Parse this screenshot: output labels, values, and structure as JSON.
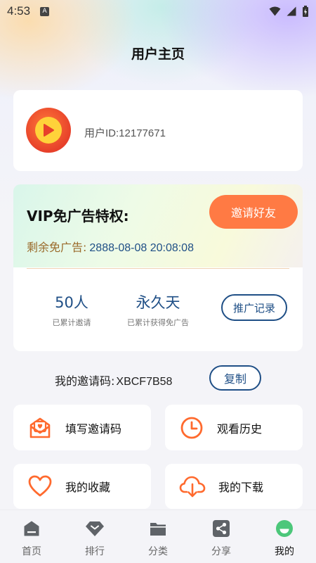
{
  "status_bar": {
    "time": "4:53",
    "indicator": "A"
  },
  "header": {
    "title": "用户主页"
  },
  "profile": {
    "user_id": "用户ID:12177671"
  },
  "vip": {
    "title": "VIP免广告特权:",
    "invite_button": "邀请好友",
    "remaining_label": "剩余免广告:",
    "remaining_date": "2888-08-08 20:08:08",
    "invited_count": "50人",
    "invited_label": "已累计邀请",
    "earned_value": "永久天",
    "earned_label": "已累计获得免广告",
    "records_button": "推广记录"
  },
  "invite_code": {
    "label": "我的邀请码:",
    "code": "XBCF7B58",
    "copy_button": "复制"
  },
  "menu": [
    {
      "label": "填写邀请码",
      "icon": "envelope-heart-icon"
    },
    {
      "label": "观看历史",
      "icon": "clock-icon"
    },
    {
      "label": "我的收藏",
      "icon": "heart-icon"
    },
    {
      "label": "我的下载",
      "icon": "cloud-download-icon"
    }
  ],
  "tabs": [
    {
      "label": "首页",
      "icon": "home-icon"
    },
    {
      "label": "排行",
      "icon": "diamond-icon"
    },
    {
      "label": "分类",
      "icon": "folder-icon"
    },
    {
      "label": "分享",
      "icon": "share-icon"
    },
    {
      "label": "我的",
      "icon": "profile-icon",
      "active": true
    }
  ],
  "colors": {
    "accent_orange": "#ff7a44",
    "accent_blue": "#1f4f86",
    "active_tab_green": "#4cc77a",
    "inactive_tab_gray": "#5f6368"
  }
}
